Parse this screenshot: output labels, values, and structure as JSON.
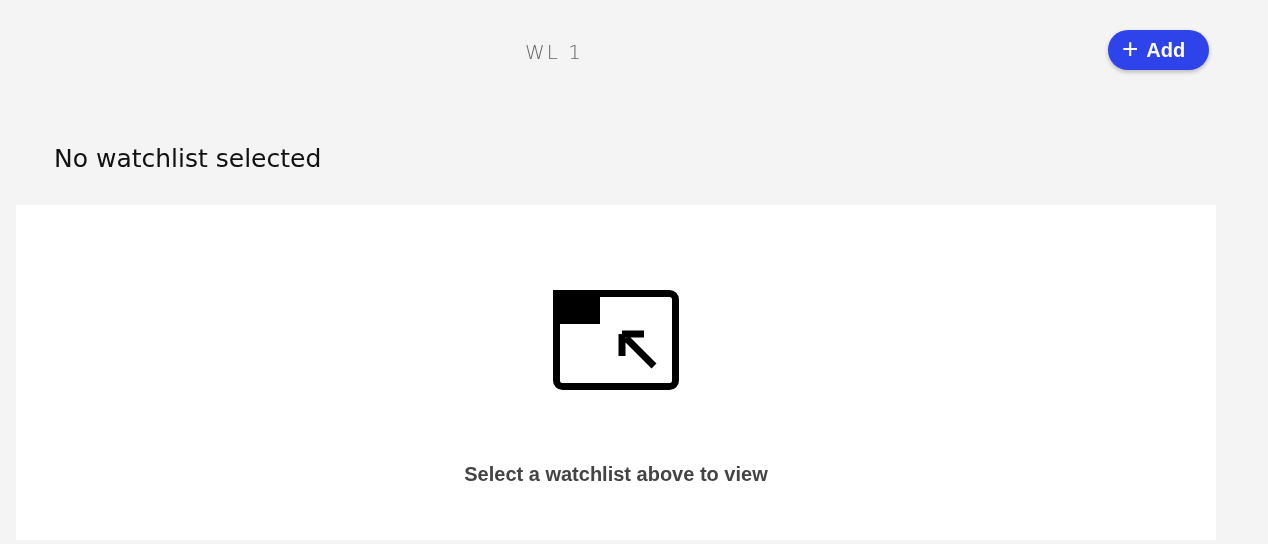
{
  "tabs": [
    {
      "label": "WL 1",
      "selected": false
    }
  ],
  "add_button": {
    "icon": "+",
    "label": "Add"
  },
  "heading": "No watchlist selected",
  "empty_state": {
    "message": "Select a watchlist above to view"
  }
}
